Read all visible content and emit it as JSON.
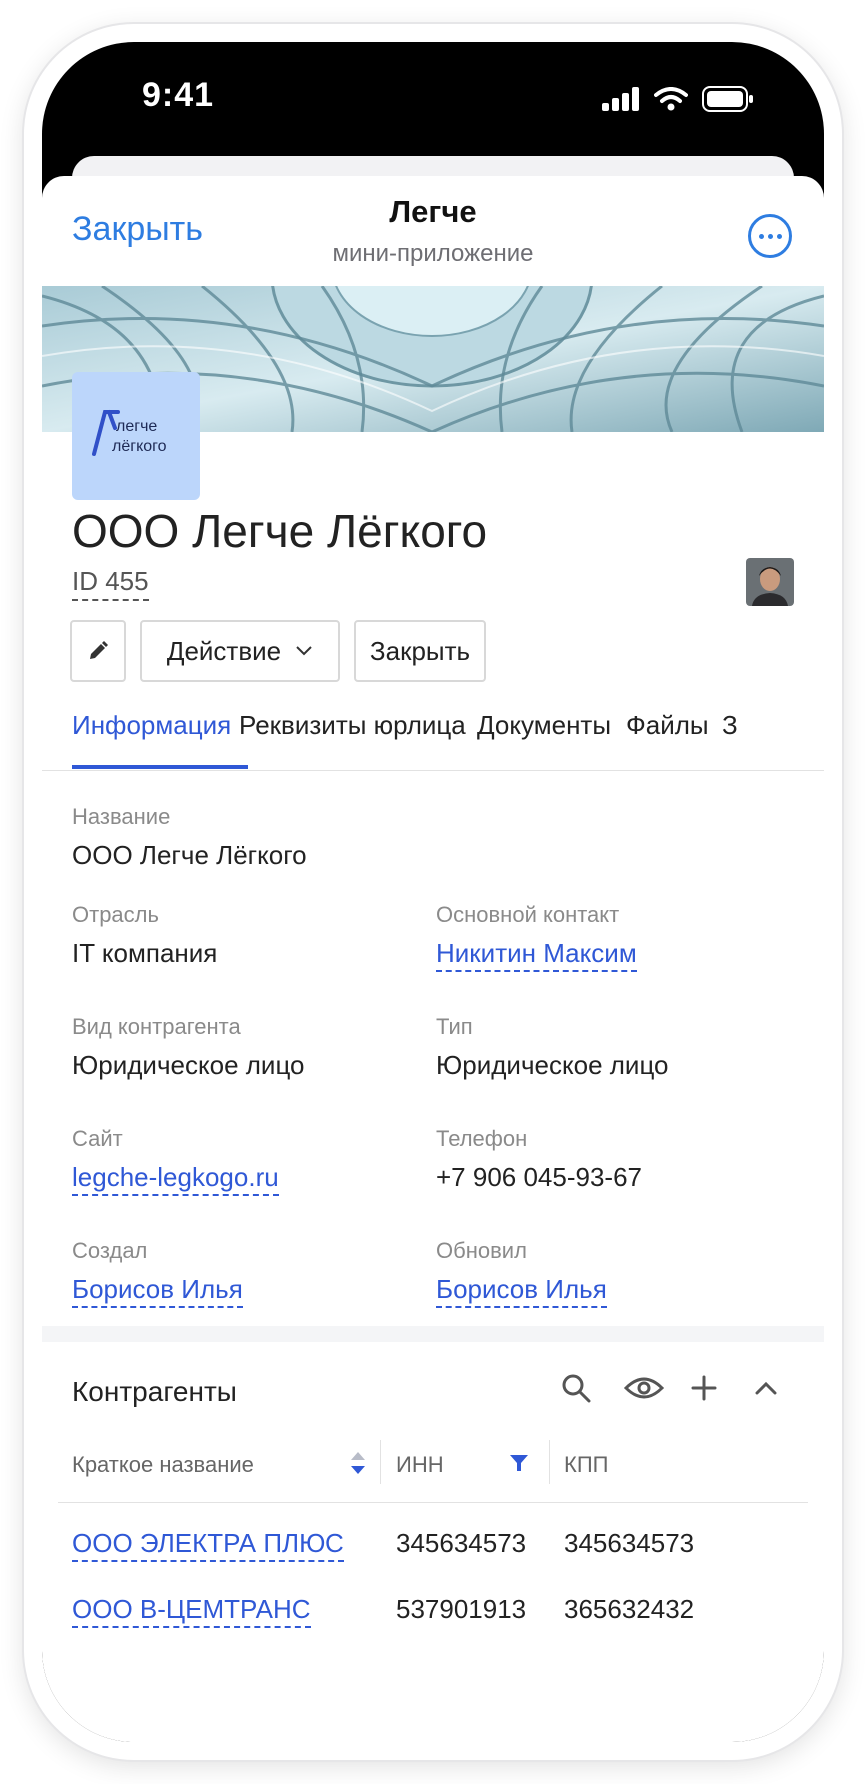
{
  "status_bar": {
    "time": "9:41"
  },
  "nav": {
    "close_label": "Закрыть",
    "title": "Легче",
    "subtitle": "мини-приложение"
  },
  "logo": {
    "line1": "легче",
    "line2": "лёгкого"
  },
  "company": {
    "name": "ООО Легче Лёгкого",
    "id": "ID 455"
  },
  "actions": {
    "action_label": "Действие",
    "close_label": "Закрыть"
  },
  "tabs": [
    {
      "label": "Информация",
      "active": true
    },
    {
      "label": "Реквизиты юрлица"
    },
    {
      "label": "Документы"
    },
    {
      "label": "Файлы"
    },
    {
      "label": "З"
    }
  ],
  "info": {
    "name_label": "Название",
    "name_value": "ООО Легче Лёгкого",
    "industry_label": "Отрасль",
    "industry_value": "IT компания",
    "contact_label": "Основной контакт",
    "contact_value": "Никитин Максим",
    "kind_label": "Вид контрагента",
    "kind_value": "Юридическое лицо",
    "type_label": "Тип",
    "type_value": "Юридическое лицо",
    "site_label": "Сайт",
    "site_value": "legche-legkogo.ru",
    "phone_label": "Телефон",
    "phone_value": "+7 906 045-93-67",
    "created_label": "Создал",
    "created_value": "Борисов Илья",
    "updated_label": "Обновил",
    "updated_value": "Борисов Илья"
  },
  "counterparties": {
    "title": "Контрагенты",
    "columns": [
      "Краткое название",
      "ИНН",
      "КПП"
    ],
    "rows": [
      {
        "name": "ООО ЭЛЕКТРА ПЛЮС",
        "inn": "345634573",
        "kpp": "345634573"
      },
      {
        "name": "ООО В-ЦЕМТРАНС",
        "inn": "537901913",
        "kpp": "365632432"
      }
    ]
  },
  "colors": {
    "accent": "#2f58d6",
    "ios_blue": "#2e7de1",
    "logo_bg": "#bcd6fb"
  }
}
